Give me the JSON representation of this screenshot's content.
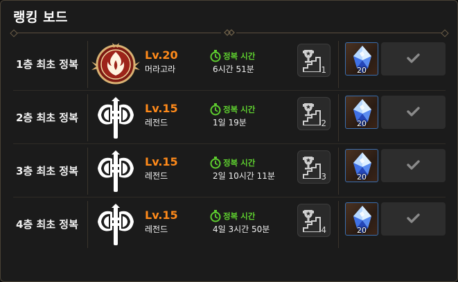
{
  "panel": {
    "title": "랭킹 보드",
    "colors": {
      "level": "#ff8a1a",
      "clear_label": "#5fd12f",
      "reward_border": "#3a6fb0",
      "background": "#1b1b1b"
    }
  },
  "rows": [
    {
      "floor": "1층 최초 정복",
      "emblem_icon": "flame-crest-emblem-icon",
      "level": "Lv.20",
      "guild_name": "머라고라",
      "clear_label": "정복 시간",
      "clear_time": "6시간 51분",
      "trophy_icon": "trophy-stairs-icon",
      "rank": "1",
      "reward_icon": "blue-crystal-icon",
      "reward_count": "20",
      "check_icon": "check-icon"
    },
    {
      "floor": "2층 최초 정복",
      "emblem_icon": "axe-emblem-icon",
      "level": "Lv.15",
      "guild_name": "레전드",
      "clear_label": "정복 시간",
      "clear_time": "1일 19분",
      "trophy_icon": "trophy-stairs-icon",
      "rank": "2",
      "reward_icon": "blue-crystal-icon",
      "reward_count": "20",
      "check_icon": "check-icon"
    },
    {
      "floor": "3층 최초 정복",
      "emblem_icon": "axe-emblem-icon",
      "level": "Lv.15",
      "guild_name": "레전드",
      "clear_label": "정복 시간",
      "clear_time": "2일 10시간 11분",
      "trophy_icon": "trophy-stairs-icon",
      "rank": "3",
      "reward_icon": "blue-crystal-icon",
      "reward_count": "20",
      "check_icon": "check-icon"
    },
    {
      "floor": "4층 최초 정복",
      "emblem_icon": "axe-emblem-icon",
      "level": "Lv.15",
      "guild_name": "레전드",
      "clear_label": "정복 시간",
      "clear_time": "4일 3시간 50분",
      "trophy_icon": "trophy-stairs-icon",
      "rank": "4",
      "reward_icon": "blue-crystal-icon",
      "reward_count": "20",
      "check_icon": "check-icon"
    }
  ]
}
